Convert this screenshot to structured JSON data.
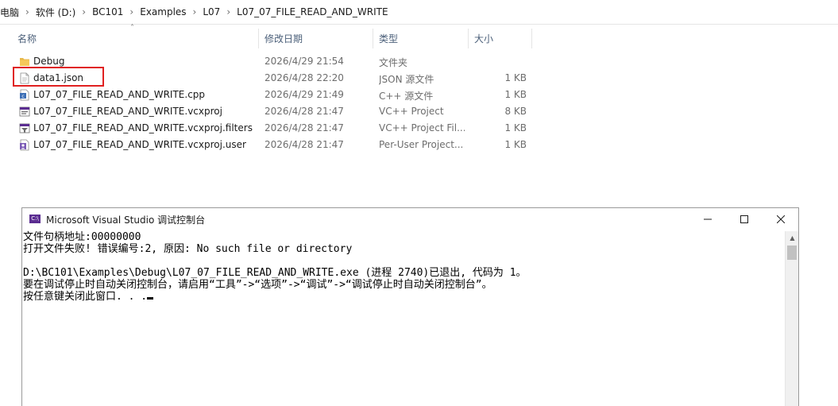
{
  "breadcrumb": [
    "此电脑",
    "软件 (D:)",
    "BC101",
    "Examples",
    "L07",
    "L07_07_FILE_READ_AND_WRITE"
  ],
  "columns": {
    "name": "名称",
    "date": "修改日期",
    "type": "类型",
    "size": "大小"
  },
  "files": [
    {
      "name": "Debug",
      "date": "2026/4/29 21:54",
      "type": "文件夹",
      "size": "",
      "icon": "folder-icon"
    },
    {
      "name": "data1.json",
      "date": "2026/4/28 22:20",
      "type": "JSON 源文件",
      "size": "1 KB",
      "icon": "json-file-icon"
    },
    {
      "name": "L07_07_FILE_READ_AND_WRITE.cpp",
      "date": "2026/4/29 21:49",
      "type": "C++ 源文件",
      "size": "1 KB",
      "icon": "cpp-file-icon"
    },
    {
      "name": "L07_07_FILE_READ_AND_WRITE.vcxproj",
      "date": "2026/4/28 21:47",
      "type": "VC++ Project",
      "size": "8 KB",
      "icon": "vcxproj-file-icon"
    },
    {
      "name": "L07_07_FILE_READ_AND_WRITE.vcxproj.filters",
      "date": "2026/4/28 21:47",
      "type": "VC++ Project Fil...",
      "size": "1 KB",
      "icon": "filters-file-icon"
    },
    {
      "name": "L07_07_FILE_READ_AND_WRITE.vcxproj.user",
      "date": "2026/4/28 21:47",
      "type": "Per-User Project...",
      "size": "1 KB",
      "icon": "user-file-icon"
    }
  ],
  "console": {
    "icon_text": "C:\\",
    "title": "Microsoft Visual Studio 调试控制台",
    "lines": [
      "文件句柄地址:00000000",
      "打开文件失败! 错误编号:2, 原因: No such file or directory",
      "",
      "D:\\BC101\\Examples\\Debug\\L07_07_FILE_READ_AND_WRITE.exe (进程 2740)已退出, 代码为 1。",
      "要在调试停止时自动关闭控制台，请启用“工具”->“选项”->“调试”->“调试停止时自动关闭控制台”。",
      "按任意键关闭此窗口. . ."
    ]
  },
  "colors": {
    "highlight": "#e02020",
    "folder": "#e8b84a",
    "vs_purple": "#5b2d91"
  }
}
